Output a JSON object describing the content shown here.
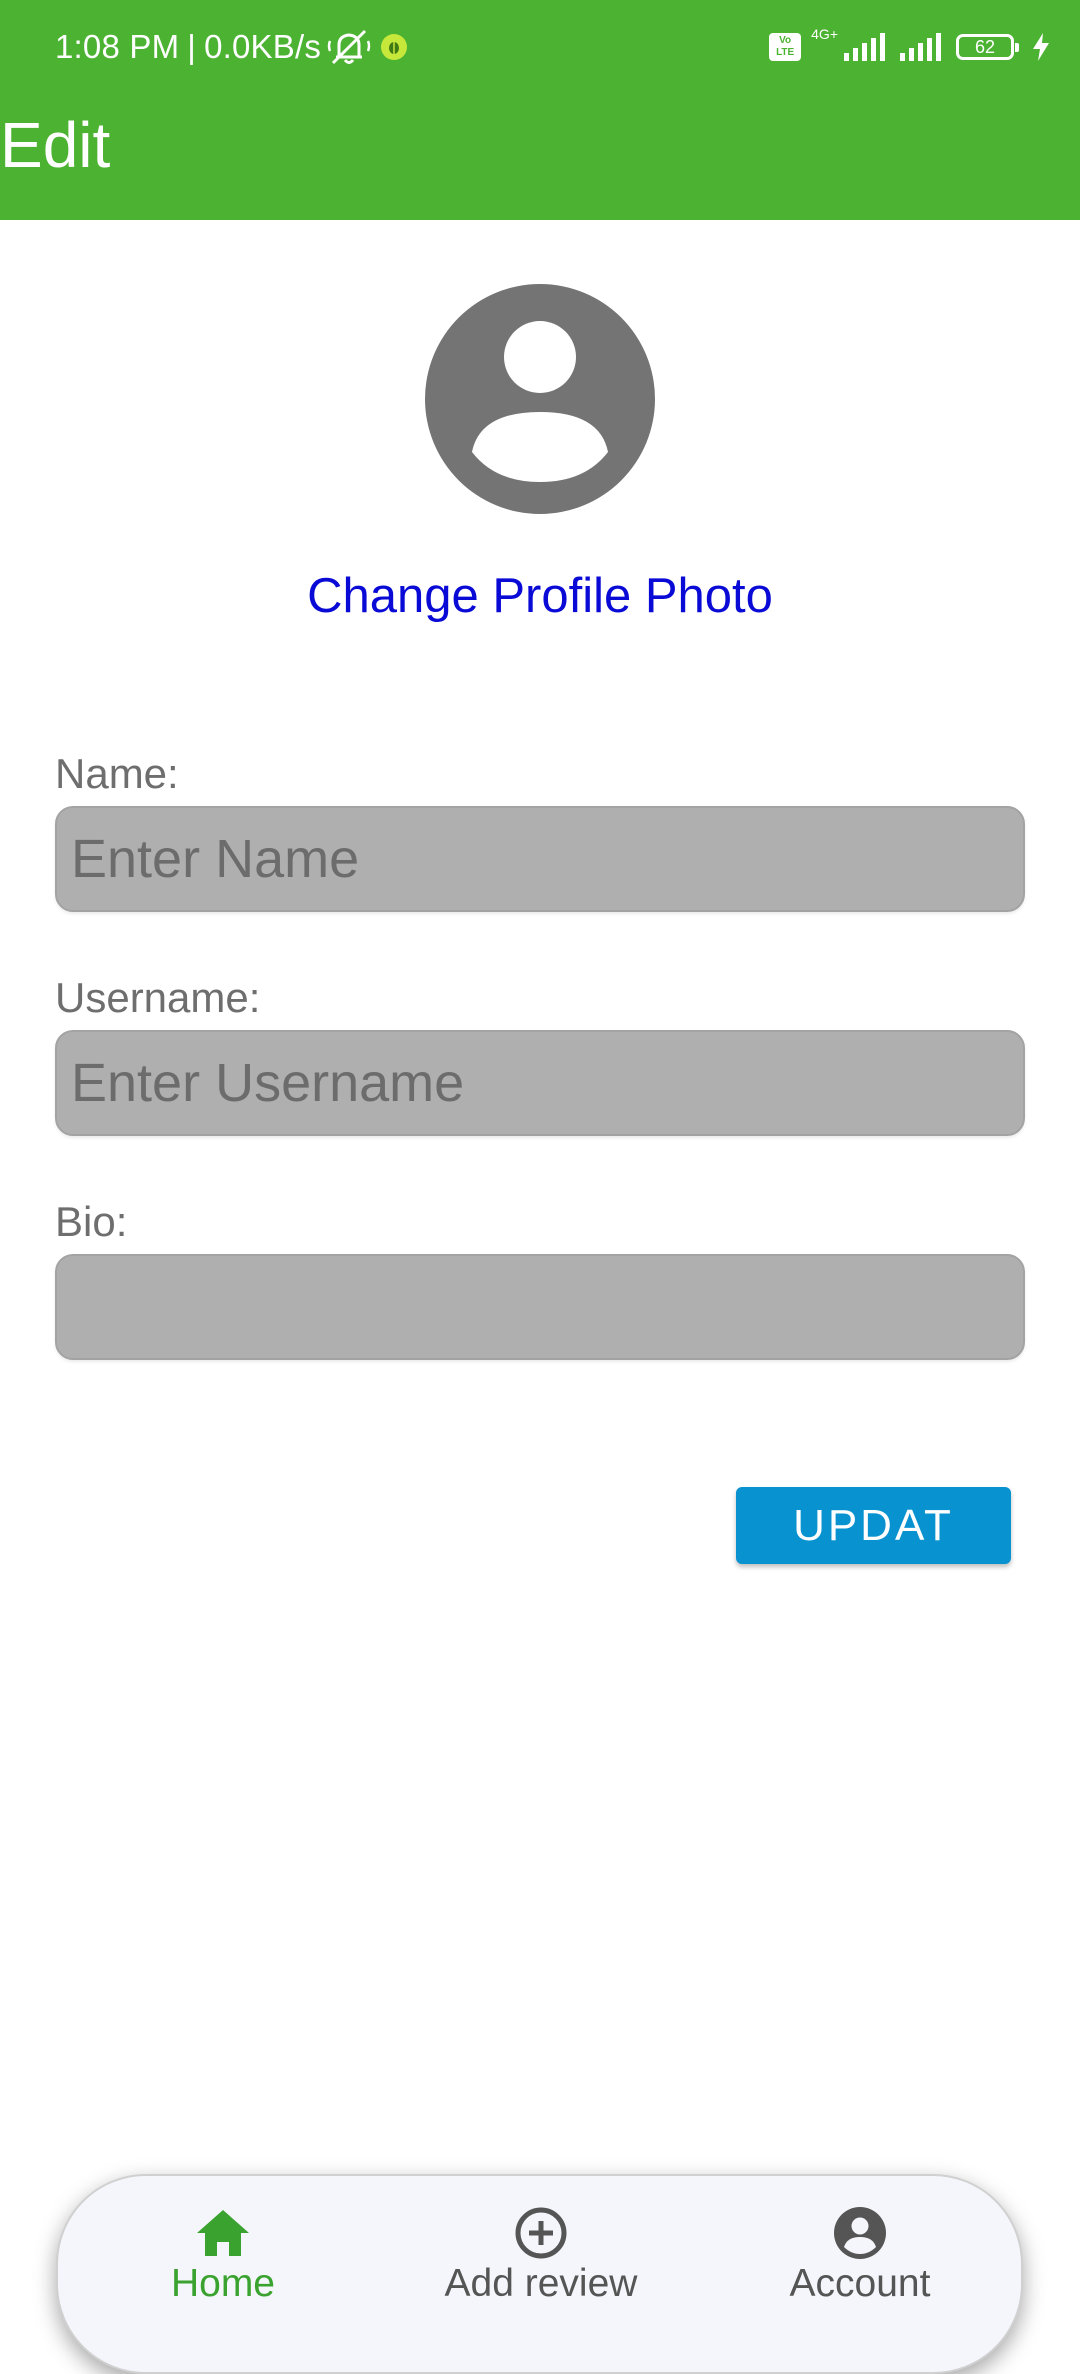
{
  "status_bar": {
    "time": "1:08 PM",
    "separator": "|",
    "speed": "0.0KB/s",
    "volte": "Vo LTE",
    "network": "4G+",
    "battery": "62"
  },
  "app_bar": {
    "title": "Edit"
  },
  "profile": {
    "change_photo_label": "Change Profile Photo"
  },
  "form": {
    "name_label": "Name:",
    "name_placeholder": "Enter Name",
    "name_value": "",
    "username_label": "Username:",
    "username_placeholder": "Enter Username",
    "username_value": "",
    "bio_label": "Bio:",
    "bio_value": "",
    "update_label": "UPDAT"
  },
  "bottom_nav": {
    "items": [
      {
        "label": "Home",
        "icon": "home-icon",
        "active": true
      },
      {
        "label": "Add review",
        "icon": "add-circle-icon",
        "active": false
      },
      {
        "label": "Account",
        "icon": "account-circle-icon",
        "active": false
      }
    ]
  },
  "colors": {
    "app_bar": "#4cb232",
    "link": "#0a0ad6",
    "button": "#0892d0",
    "active_nav": "#3aa22e",
    "input_bg": "#afafaf"
  }
}
